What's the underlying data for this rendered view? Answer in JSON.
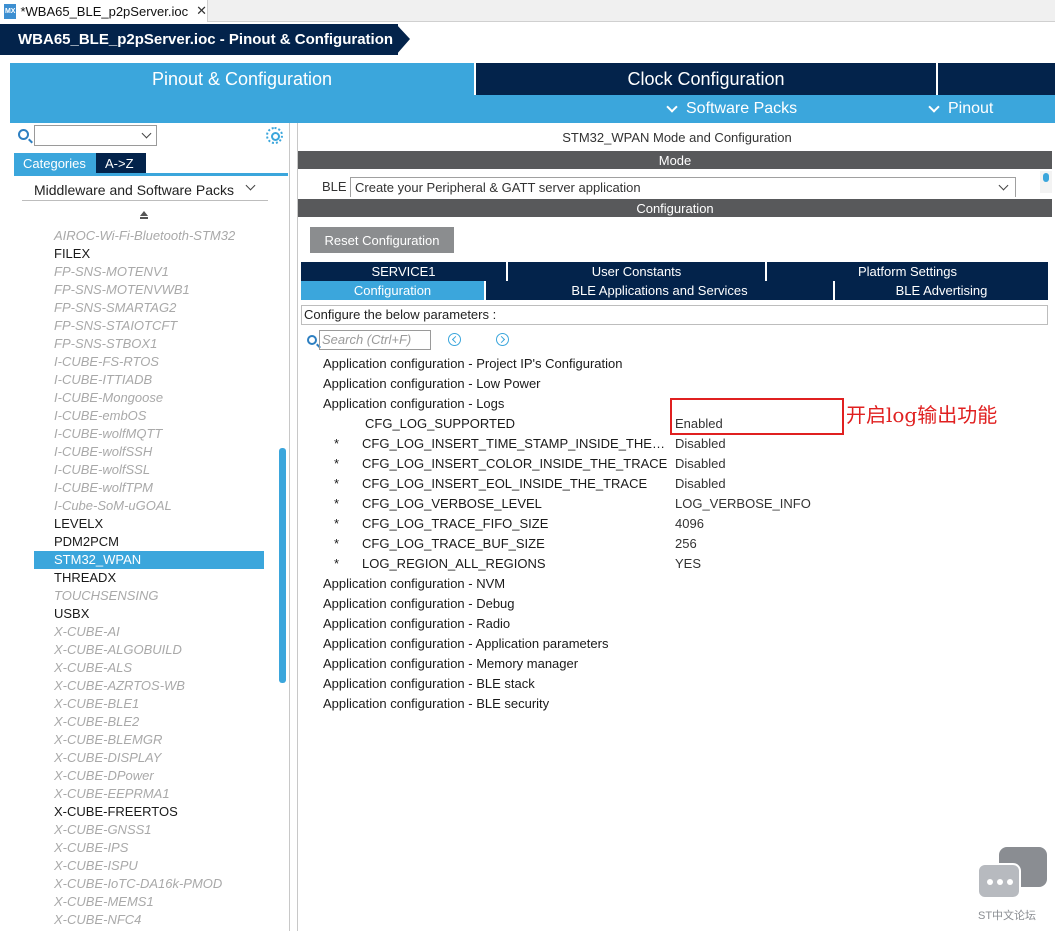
{
  "file_tab": {
    "icon": "MX",
    "label": "*WBA65_BLE_p2pServer.ioc",
    "close": "✕"
  },
  "breadcrumb": {
    "label": "WBA65_BLE_p2pServer.ioc - Pinout & Configuration"
  },
  "main_tabs": {
    "pinout": "Pinout & Configuration",
    "clock": "Clock Configuration"
  },
  "sub_menu": {
    "software_packs": "Software Packs",
    "pinout": "Pinout"
  },
  "left": {
    "category_tabs": {
      "categories": "Categories",
      "az": "A->Z"
    },
    "category_select": "Middleware and Software Packs",
    "items": [
      {
        "label": "AIROC-Wi-Fi-Bluetooth-STM32",
        "state": "disabled"
      },
      {
        "label": "FILEX",
        "state": "enabled"
      },
      {
        "label": "FP-SNS-MOTENV1",
        "state": "disabled"
      },
      {
        "label": "FP-SNS-MOTENVWB1",
        "state": "disabled"
      },
      {
        "label": "FP-SNS-SMARTAG2",
        "state": "disabled"
      },
      {
        "label": "FP-SNS-STAIOTCFT",
        "state": "disabled"
      },
      {
        "label": "FP-SNS-STBOX1",
        "state": "disabled"
      },
      {
        "label": "I-CUBE-FS-RTOS",
        "state": "disabled"
      },
      {
        "label": "I-CUBE-ITTIADB",
        "state": "disabled"
      },
      {
        "label": "I-CUBE-Mongoose",
        "state": "disabled"
      },
      {
        "label": "I-CUBE-embOS",
        "state": "disabled"
      },
      {
        "label": "I-CUBE-wolfMQTT",
        "state": "disabled"
      },
      {
        "label": "I-CUBE-wolfSSH",
        "state": "disabled"
      },
      {
        "label": "I-CUBE-wolfSSL",
        "state": "disabled"
      },
      {
        "label": "I-CUBE-wolfTPM",
        "state": "disabled"
      },
      {
        "label": "I-Cube-SoM-uGOAL",
        "state": "disabled"
      },
      {
        "label": "LEVELX",
        "state": "enabled"
      },
      {
        "label": "PDM2PCM",
        "state": "enabled"
      },
      {
        "label": "STM32_WPAN",
        "state": "selected"
      },
      {
        "label": "THREADX",
        "state": "enabled"
      },
      {
        "label": "TOUCHSENSING",
        "state": "disabled"
      },
      {
        "label": "USBX",
        "state": "enabled"
      },
      {
        "label": "X-CUBE-AI",
        "state": "disabled"
      },
      {
        "label": "X-CUBE-ALGOBUILD",
        "state": "disabled"
      },
      {
        "label": "X-CUBE-ALS",
        "state": "disabled"
      },
      {
        "label": "X-CUBE-AZRTOS-WB",
        "state": "disabled"
      },
      {
        "label": "X-CUBE-BLE1",
        "state": "disabled"
      },
      {
        "label": "X-CUBE-BLE2",
        "state": "disabled"
      },
      {
        "label": "X-CUBE-BLEMGR",
        "state": "disabled"
      },
      {
        "label": "X-CUBE-DISPLAY",
        "state": "disabled"
      },
      {
        "label": "X-CUBE-DPower",
        "state": "disabled"
      },
      {
        "label": "X-CUBE-EEPRMA1",
        "state": "disabled"
      },
      {
        "label": "X-CUBE-FREERTOS",
        "state": "enabled"
      },
      {
        "label": "X-CUBE-GNSS1",
        "state": "disabled"
      },
      {
        "label": "X-CUBE-IPS",
        "state": "disabled"
      },
      {
        "label": "X-CUBE-ISPU",
        "state": "disabled"
      },
      {
        "label": "X-CUBE-IoTC-DA16k-PMOD",
        "state": "disabled"
      },
      {
        "label": "X-CUBE-MEMS1",
        "state": "disabled"
      },
      {
        "label": "X-CUBE-NFC4",
        "state": "disabled"
      }
    ]
  },
  "right": {
    "mode_title": "STM32_WPAN Mode and Configuration",
    "mode_bar": "Mode",
    "ble_label": "BLE",
    "ble_value": "Create your Peripheral & GATT server application",
    "config_bar": "Configuration",
    "reset_button": "Reset Configuration",
    "tabs_row1": [
      "SERVICE1",
      "User Constants",
      "Platform Settings"
    ],
    "tabs_row2": [
      "Configuration",
      "BLE Applications and Services",
      "BLE Advertising"
    ],
    "configure_hint": "Configure the below parameters :",
    "search_placeholder": "Search (Ctrl+F)",
    "params": [
      {
        "name": "Application configuration - Project IP's Configuration",
        "value": ""
      },
      {
        "name": "Application configuration - Low Power",
        "value": ""
      },
      {
        "name": "Application configuration - Logs",
        "value": ""
      },
      {
        "name": "CFG_LOG_SUPPORTED",
        "value": "Enabled"
      },
      {
        "name": "CFG_LOG_INSERT_TIME_STAMP_INSIDE_THE_TRACE",
        "value": "Disabled",
        "star": "*"
      },
      {
        "name": "CFG_LOG_INSERT_COLOR_INSIDE_THE_TRACE",
        "value": "Disabled",
        "star": "*"
      },
      {
        "name": "CFG_LOG_INSERT_EOL_INSIDE_THE_TRACE",
        "value": "Disabled",
        "star": "*"
      },
      {
        "name": "CFG_LOG_VERBOSE_LEVEL",
        "value": "LOG_VERBOSE_INFO",
        "star": "*"
      },
      {
        "name": "CFG_LOG_TRACE_FIFO_SIZE",
        "value": "4096",
        "star": "*"
      },
      {
        "name": "CFG_LOG_TRACE_BUF_SIZE",
        "value": "256",
        "star": "*"
      },
      {
        "name": "LOG_REGION_ALL_REGIONS",
        "value": "YES",
        "star": "*"
      },
      {
        "name": "Application configuration - NVM",
        "value": ""
      },
      {
        "name": "Application configuration - Debug",
        "value": ""
      },
      {
        "name": "Application configuration - Radio",
        "value": ""
      },
      {
        "name": "Application configuration - Application parameters",
        "value": ""
      },
      {
        "name": "Application configuration - Memory manager",
        "value": ""
      },
      {
        "name": "Application configuration - BLE stack",
        "value": ""
      },
      {
        "name": "Application configuration - BLE security",
        "value": ""
      }
    ],
    "annotation": "开启log输出功能"
  },
  "forum_badge": "ST中文论坛",
  "colors": {
    "navy": "#03234b",
    "accent": "#3ba6dc",
    "annotation": "#e02020"
  }
}
